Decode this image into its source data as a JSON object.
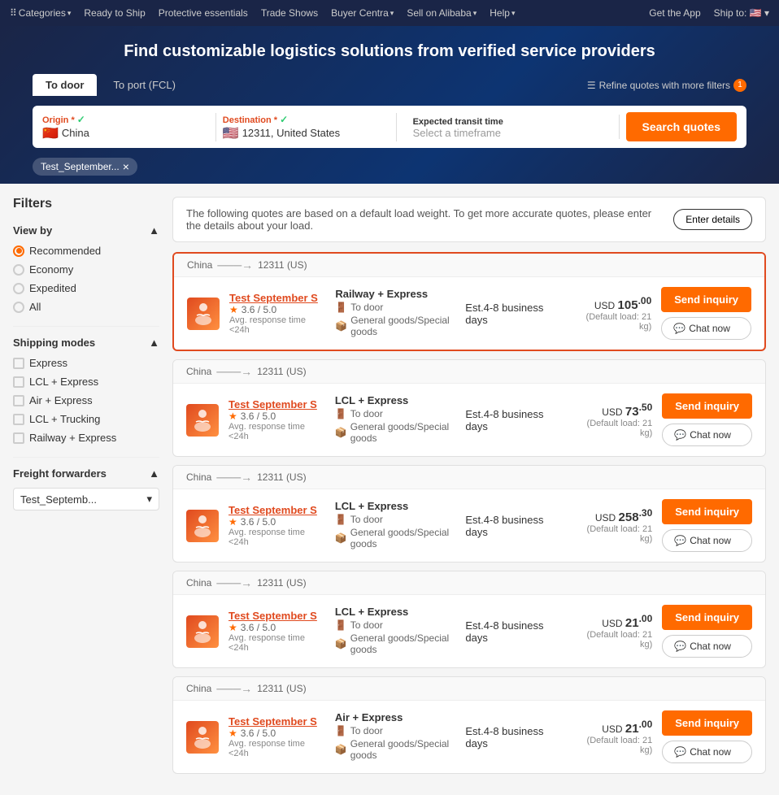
{
  "topnav": {
    "items": [
      "Categories",
      "Ready to Ship",
      "Protective essentials",
      "Trade Shows",
      "Buyer Centra",
      "Sell on Alibaba",
      "Help"
    ],
    "right_items": [
      "Get the App",
      "Ship to:"
    ],
    "categories_chevron": "▾",
    "buyer_centra_chevron": "▾",
    "sell_chevron": "▾",
    "help_chevron": "▾"
  },
  "hero": {
    "title": "Find customizable logistics solutions from verified service providers",
    "tab_door": "To door",
    "tab_port": "To port (FCL)",
    "refine_label": "Refine quotes with more filters",
    "refine_count": "1",
    "origin_label": "Origin",
    "origin_required": "*",
    "origin_check": "✓",
    "origin_flag": "🇨🇳",
    "origin_value": "China",
    "destination_label": "Destination",
    "destination_required": "*",
    "destination_check": "✓",
    "destination_flag": "🇺🇸",
    "destination_value": "12311, United States",
    "transit_label": "Expected transit time",
    "transit_placeholder": "Select a timeframe",
    "search_btn": "Search quotes",
    "tag_label": "Test_September...",
    "tag_close": "×"
  },
  "filters": {
    "title": "Filters",
    "view_by": "View by",
    "options": [
      "Recommended",
      "Economy",
      "Expedited",
      "All"
    ],
    "selected_option": "Recommended",
    "shipping_modes": "Shipping modes",
    "mode_options": [
      "Express",
      "LCL + Express",
      "Air + Express",
      "LCL + Trucking",
      "Railway + Express"
    ],
    "freight_forwarders": "Freight forwarders",
    "forwarder_value": "Test_Septemb..."
  },
  "results": {
    "note": "The following quotes are based on a default load weight. To get more accurate quotes, please enter the details about your load.",
    "enter_details_btn": "Enter details",
    "send_inquiry_label": "Send inquiry",
    "chat_now_label": "Chat now",
    "quotes": [
      {
        "id": 1,
        "route_from": "China",
        "route_to": "12311 (US)",
        "company": "Test September S",
        "rating": "3.6 / 5.0",
        "response": "Avg. response time <24h",
        "mode": "Railway + Express",
        "delivery": "To door",
        "goods": "General goods/Special goods",
        "transit": "Est.4-8 business days",
        "price_int": "105",
        "price_dec": "00",
        "currency": "USD",
        "default_load": "Default load: 21 kg",
        "highlighted": true
      },
      {
        "id": 2,
        "route_from": "China",
        "route_to": "12311 (US)",
        "company": "Test September S",
        "rating": "3.6 / 5.0",
        "response": "Avg. response time <24h",
        "mode": "LCL + Express",
        "delivery": "To door",
        "goods": "General goods/Special goods",
        "transit": "Est.4-8 business days",
        "price_int": "73",
        "price_dec": "50",
        "currency": "USD",
        "default_load": "Default load: 21 kg",
        "highlighted": false
      },
      {
        "id": 3,
        "route_from": "China",
        "route_to": "12311 (US)",
        "company": "Test September S",
        "rating": "3.6 / 5.0",
        "response": "Avg. response time <24h",
        "mode": "LCL + Express",
        "delivery": "To door",
        "goods": "General goods/Special goods",
        "transit": "Est.4-8 business days",
        "price_int": "258",
        "price_dec": "30",
        "currency": "USD",
        "default_load": "Default load: 21 kg",
        "highlighted": false
      },
      {
        "id": 4,
        "route_from": "China",
        "route_to": "12311 (US)",
        "company": "Test September S",
        "rating": "3.6 / 5.0",
        "response": "Avg. response time <24h",
        "mode": "LCL + Express",
        "delivery": "To door",
        "goods": "General goods/Special goods",
        "transit": "Est.4-8 business days",
        "price_int": "21",
        "price_dec": "00",
        "currency": "USD",
        "default_load": "Default load: 21 kg",
        "highlighted": false
      },
      {
        "id": 5,
        "route_from": "China",
        "route_to": "12311 (US)",
        "company": "Test September S",
        "rating": "3.6 / 5.0",
        "response": "Avg. response time <24h",
        "mode": "Air + Express",
        "delivery": "To door",
        "goods": "General goods/Special goods",
        "transit": "Est.4-8 business days",
        "price_int": "21",
        "price_dec": "00",
        "currency": "USD",
        "default_load": "Default load: 21 kg",
        "highlighted": false
      }
    ]
  }
}
